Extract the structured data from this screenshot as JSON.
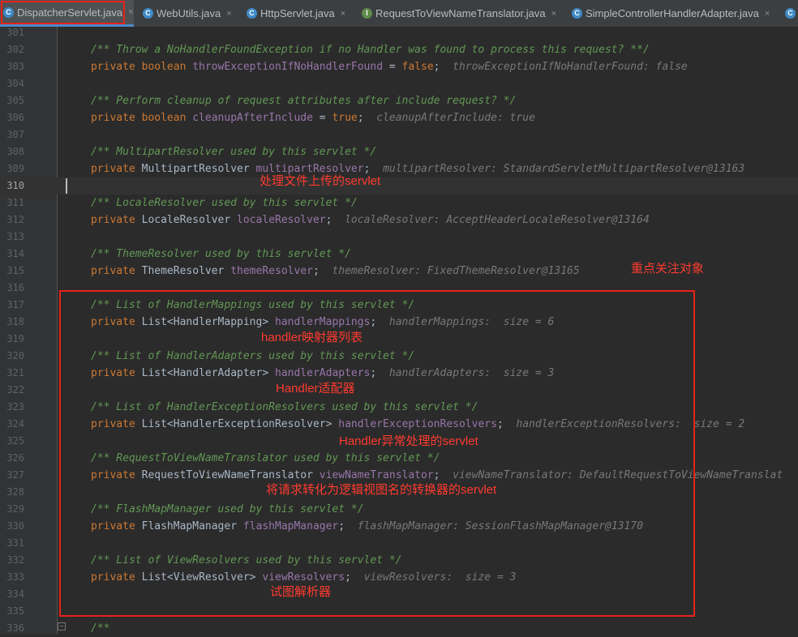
{
  "tabs": [
    {
      "label": "DispatcherServlet.java",
      "icon": "class-icon",
      "icon_letter": "C",
      "active": true
    },
    {
      "label": "WebUtils.java",
      "icon": "class-icon",
      "icon_letter": "C"
    },
    {
      "label": "HttpServlet.java",
      "icon": "class-icon",
      "icon_letter": "C"
    },
    {
      "label": "RequestToViewNameTranslator.java",
      "icon": "interface-icon",
      "icon_letter": "I"
    },
    {
      "label": "SimpleControllerHandlerAdapter.java",
      "icon": "class-icon",
      "icon_letter": "C"
    }
  ],
  "tab_close_glyph": "×",
  "current_line": "310",
  "lines": [
    {
      "n": "301"
    },
    {
      "n": "302",
      "kind": "doc",
      "text": "/** Throw a NoHandlerFoundException if no Handler was found to process this request? **/"
    },
    {
      "n": "303",
      "kind": "decl",
      "kw": "private boolean",
      "type": "",
      "field": "throwExceptionIfNoHandlerFound",
      "rest": " = ",
      "value": "false",
      "end": ";",
      "hint": "throwExceptionIfNoHandlerFound: false"
    },
    {
      "n": "304"
    },
    {
      "n": "305",
      "kind": "doc",
      "text": "/** Perform cleanup of request attributes after include request? */"
    },
    {
      "n": "306",
      "kind": "decl",
      "kw": "private boolean",
      "type": "",
      "field": "cleanupAfterInclude",
      "rest": " = ",
      "value": "true",
      "end": ";",
      "hint": "cleanupAfterInclude: true"
    },
    {
      "n": "307"
    },
    {
      "n": "308",
      "kind": "doc",
      "text": "/** MultipartResolver used by this servlet */"
    },
    {
      "n": "309",
      "kind": "decl",
      "kw": "private",
      "type": "MultipartResolver",
      "field": "multipartResolver",
      "end": ";",
      "hint": "multipartResolver: StandardServletMultipartResolver@13163"
    },
    {
      "n": "310"
    },
    {
      "n": "311",
      "kind": "doc",
      "text": "/** LocaleResolver used by this servlet */"
    },
    {
      "n": "312",
      "kind": "decl",
      "kw": "private",
      "type": "LocaleResolver",
      "field": "localeResolver",
      "end": ";",
      "hint": "localeResolver: AcceptHeaderLocaleResolver@13164"
    },
    {
      "n": "313"
    },
    {
      "n": "314",
      "kind": "doc",
      "text": "/** ThemeResolver used by this servlet */"
    },
    {
      "n": "315",
      "kind": "decl",
      "kw": "private",
      "type": "ThemeResolver",
      "field": "themeResolver",
      "end": ";",
      "hint": "themeResolver: FixedThemeResolver@13165"
    },
    {
      "n": "316"
    },
    {
      "n": "317",
      "kind": "doc",
      "text": "/** List of HandlerMappings used by this servlet */"
    },
    {
      "n": "318",
      "kind": "decl",
      "kw": "private",
      "type": "List<HandlerMapping>",
      "field": "handlerMappings",
      "end": ";",
      "hint": "handlerMappings:  size = 6"
    },
    {
      "n": "319"
    },
    {
      "n": "320",
      "kind": "doc",
      "text": "/** List of HandlerAdapters used by this servlet */"
    },
    {
      "n": "321",
      "kind": "decl",
      "kw": "private",
      "type": "List<HandlerAdapter>",
      "field": "handlerAdapters",
      "end": ";",
      "hint": "handlerAdapters:  size = 3"
    },
    {
      "n": "322"
    },
    {
      "n": "323",
      "kind": "doc",
      "text": "/** List of HandlerExceptionResolvers used by this servlet */"
    },
    {
      "n": "324",
      "kind": "decl",
      "kw": "private",
      "type": "List<HandlerExceptionResolver>",
      "field": "handlerExceptionResolvers",
      "end": ";",
      "hint": "handlerExceptionResolvers:  size = 2"
    },
    {
      "n": "325"
    },
    {
      "n": "326",
      "kind": "doc",
      "text": "/** RequestToViewNameTranslator used by this servlet */"
    },
    {
      "n": "327",
      "kind": "decl",
      "kw": "private",
      "type": "RequestToViewNameTranslator",
      "field": "viewNameTranslator",
      "end": ";",
      "hint": "viewNameTranslator: DefaultRequestToViewNameTranslat"
    },
    {
      "n": "328"
    },
    {
      "n": "329",
      "kind": "doc",
      "text": "/** FlashMapManager used by this servlet */"
    },
    {
      "n": "330",
      "kind": "decl",
      "kw": "private",
      "type": "FlashMapManager",
      "field": "flashMapManager",
      "end": ";",
      "hint": "flashMapManager: SessionFlashMapManager@13170"
    },
    {
      "n": "331"
    },
    {
      "n": "332",
      "kind": "doc",
      "text": "/** List of ViewResolvers used by this servlet */"
    },
    {
      "n": "333",
      "kind": "decl",
      "kw": "private",
      "type": "List<ViewResolver>",
      "field": "viewResolvers",
      "end": ";",
      "hint": "viewResolvers:  size = 3"
    },
    {
      "n": "334"
    },
    {
      "n": "335"
    },
    {
      "n": "336",
      "kind": "doc",
      "text": "/**"
    }
  ],
  "annotations": {
    "multipart": "处理文件上传的servlet",
    "focus": "重点关注对象",
    "mappings": "handler映射器列表",
    "adapters": "Handler适配器",
    "exceptions": "Handler异常处理的servlet",
    "translator": "将请求转化为逻辑视图名的转换器的servlet",
    "view_resolvers": "试图解析器"
  },
  "colors": {
    "editor_bg": "#2b2b2b",
    "keyword": "#cc7832",
    "doc_comment": "#629755",
    "field": "#9876aa",
    "inline_hint": "#787878",
    "annotation_red": "#ff3b2f"
  }
}
